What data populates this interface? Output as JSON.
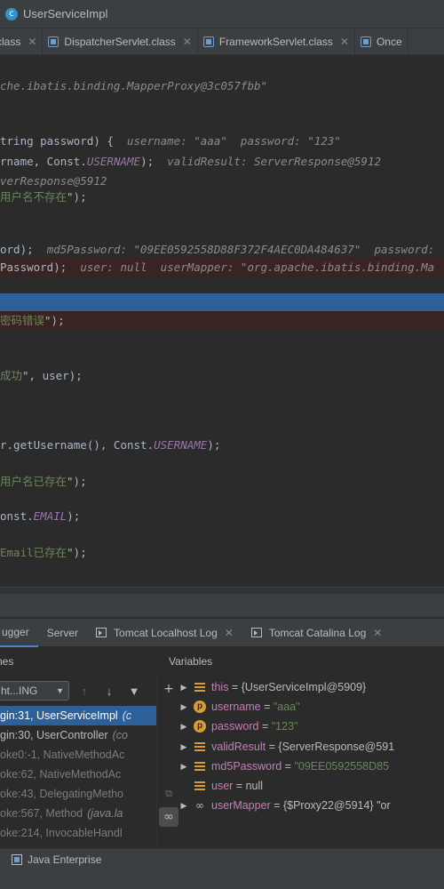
{
  "window": {
    "title": "UserServiceImpl"
  },
  "tabs": [
    {
      "label": "class"
    },
    {
      "label": "DispatcherServlet.class"
    },
    {
      "label": "FrameworkServlet.class"
    },
    {
      "label": "Once"
    }
  ],
  "editor": {
    "lines": [
      {
        "segments": [
          {
            "text": "che.ibatis.binding.MapperProxy@3c057fbb\"",
            "style": "hint"
          }
        ]
      },
      {
        "segments": [
          {
            "text": "tring password) {  ",
            "style": "code"
          },
          {
            "text": "username: \"aaa\"  password: \"123\"",
            "style": "hint"
          }
        ]
      },
      {
        "segments": [
          {
            "text": "rname, Const.",
            "style": "code"
          },
          {
            "text": "USERNAME",
            "style": "const"
          },
          {
            "text": ");  ",
            "style": "code"
          },
          {
            "text": "validResult: ServerResponse@5912",
            "style": "hint"
          }
        ]
      },
      {
        "segments": [
          {
            "text": "verResponse@5912",
            "style": "hint"
          }
        ]
      },
      {
        "segments": [
          {
            "text": "用户名不存在",
            "style": "str"
          },
          {
            "text": "\");",
            "style": "code"
          }
        ]
      },
      {
        "segments": [
          {
            "text": "ord);  ",
            "style": "code"
          },
          {
            "text": "md5Password: \"09EE0592558D88F372F4AEC0DA484637\"  password:",
            "style": "hint"
          }
        ]
      },
      {
        "segments": [
          {
            "text": "Password);  ",
            "style": "code"
          },
          {
            "text": "user: null  userMapper: \"org.apache.ibatis.binding.Ma",
            "style": "hint"
          }
        ]
      },
      {
        "segments": [
          {
            "text": "密码错误",
            "style": "str"
          },
          {
            "text": "\");",
            "style": "code"
          }
        ]
      },
      {
        "segments": [
          {
            "text": "成功",
            "style": "str"
          },
          {
            "text": "\", user);",
            "style": "code"
          }
        ]
      },
      {
        "segments": [
          {
            "text": "r.getUsername(), Const.",
            "style": "code"
          },
          {
            "text": "USERNAME",
            "style": "const"
          },
          {
            "text": ");",
            "style": "code"
          }
        ]
      },
      {
        "segments": [
          {
            "text": "用户名已存在",
            "style": "str"
          },
          {
            "text": "\");",
            "style": "code"
          }
        ]
      },
      {
        "segments": [
          {
            "text": "onst.",
            "style": "code"
          },
          {
            "text": "EMAIL",
            "style": "const"
          },
          {
            "text": ");",
            "style": "code"
          }
        ]
      },
      {
        "segments": [
          {
            "text": "Email已存在",
            "style": "str"
          },
          {
            "text": "\");",
            "style": "code"
          }
        ]
      }
    ]
  },
  "debugger": {
    "tabs": [
      {
        "label": "ugger"
      },
      {
        "label": "Server"
      },
      {
        "label": "Tomcat Localhost Log"
      },
      {
        "label": "Tomcat Catalina Log"
      }
    ],
    "frames_header": "nes",
    "variables_header": "Variables",
    "thread_select": "ht...ING",
    "frames": [
      {
        "method": "gin:31, UserServiceImpl",
        "location": "(c"
      },
      {
        "method": "gin:30, UserController",
        "location": "(co"
      },
      {
        "method": "oke0:-1, NativeMethodAc",
        "location": ""
      },
      {
        "method": "oke:62, NativeMethodAc",
        "location": ""
      },
      {
        "method": "oke:43, DelegatingMetho",
        "location": ""
      },
      {
        "method": "oke:567, Method",
        "location": "(java.la"
      },
      {
        "method": "oke:214, InvocableHandl",
        "location": ""
      }
    ],
    "variables": [
      {
        "name": "this",
        "value": "{UserServiceImpl@5909}",
        "kind": "object",
        "icon": "field-icon",
        "expandable": true
      },
      {
        "name": "username",
        "value": "\"aaa\"",
        "kind": "string",
        "icon": "param-icon",
        "expandable": true
      },
      {
        "name": "password",
        "value": "\"123\"",
        "kind": "string",
        "icon": "param-icon",
        "expandable": true
      },
      {
        "name": "validResult",
        "value": "{ServerResponse@591",
        "kind": "object",
        "icon": "field-icon",
        "expandable": true
      },
      {
        "name": "md5Password",
        "value": "\"09EE0592558D85",
        "kind": "string",
        "icon": "field-icon",
        "expandable": true
      },
      {
        "name": "user",
        "value": "null",
        "kind": "object",
        "icon": "field-icon",
        "expandable": false
      },
      {
        "name": "userMapper",
        "value": "{$Proxy22@5914} \"or",
        "kind": "object",
        "icon": "watch-icon",
        "expandable": true
      }
    ]
  },
  "statusbar": {
    "left": "",
    "java_enterprise": "Java Enterprise"
  },
  "colors": {
    "background": "#2b2b2b",
    "panel": "#3c3f41",
    "selection": "#2d6099",
    "breakpoint_line": "#3a2323",
    "string": "#6a8759",
    "constant": "#9876aa",
    "hint": "#8b8b8b",
    "variable_name": "#c77dbb",
    "icon_orange": "#d79b37"
  }
}
